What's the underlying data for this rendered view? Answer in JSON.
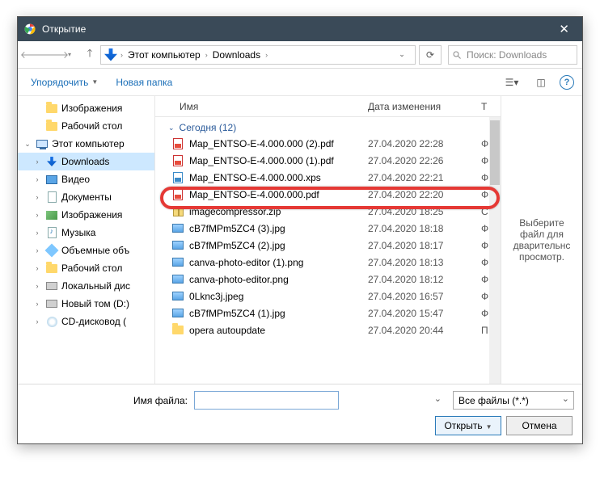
{
  "window": {
    "title": "Открытие"
  },
  "nav": {
    "crumb_root": "Этот компьютер",
    "crumb_folder": "Downloads",
    "search_placeholder": "Поиск: Downloads"
  },
  "toolbar": {
    "organize": "Упорядочить",
    "new_folder": "Новая папка"
  },
  "sidebar": {
    "items": [
      {
        "label": "Изображения",
        "icon": "folder",
        "lvl": 1
      },
      {
        "label": "Рабочий стол",
        "icon": "folder",
        "lvl": 1
      },
      {
        "label": "Этот компьютер",
        "icon": "monitor",
        "lvl": 0,
        "toggle": "⌄"
      },
      {
        "label": "Downloads",
        "icon": "dl",
        "lvl": 1,
        "toggle": "›",
        "selected": true
      },
      {
        "label": "Видео",
        "icon": "film",
        "lvl": 1,
        "toggle": "›"
      },
      {
        "label": "Документы",
        "icon": "doc",
        "lvl": 1,
        "toggle": "›"
      },
      {
        "label": "Изображения",
        "icon": "pic",
        "lvl": 1,
        "toggle": "›"
      },
      {
        "label": "Музыка",
        "icon": "note",
        "lvl": 1,
        "toggle": "›"
      },
      {
        "label": "Объемные объ",
        "icon": "cube",
        "lvl": 1,
        "toggle": "›"
      },
      {
        "label": "Рабочий стол",
        "icon": "folder",
        "lvl": 1,
        "toggle": "›"
      },
      {
        "label": "Локальный дис",
        "icon": "disk",
        "lvl": 1,
        "toggle": "›"
      },
      {
        "label": "Новый том (D:)",
        "icon": "disk",
        "lvl": 1,
        "toggle": "›"
      },
      {
        "label": "CD-дисковод (",
        "icon": "cd",
        "lvl": 1,
        "toggle": "›"
      }
    ]
  },
  "columns": {
    "name": "Имя",
    "date": "Дата изменения",
    "type": "Т"
  },
  "group": {
    "label": "Сегодня (12)"
  },
  "files": [
    {
      "name": "Map_ENTSO-E-4.000.000 (2).pdf",
      "date": "27.04.2020 22:28",
      "t": "Ф",
      "icon": "pdf"
    },
    {
      "name": "Map_ENTSO-E-4.000.000 (1).pdf",
      "date": "27.04.2020 22:26",
      "t": "Ф",
      "icon": "pdf"
    },
    {
      "name": "Map_ENTSO-E-4.000.000.xps",
      "date": "27.04.2020 22:21",
      "t": "Ф",
      "icon": "xps",
      "highlight": true
    },
    {
      "name": "Map_ENTSO-E-4.000.000.pdf",
      "date": "27.04.2020 22:20",
      "t": "Ф",
      "icon": "pdf"
    },
    {
      "name": "imagecompressor.zip",
      "date": "27.04.2020 18:25",
      "t": "С",
      "icon": "zip"
    },
    {
      "name": "cB7fMPm5ZC4 (3).jpg",
      "date": "27.04.2020 18:18",
      "t": "Ф",
      "icon": "img"
    },
    {
      "name": "cB7fMPm5ZC4 (2).jpg",
      "date": "27.04.2020 18:17",
      "t": "Ф",
      "icon": "img"
    },
    {
      "name": "canva-photo-editor (1).png",
      "date": "27.04.2020 18:13",
      "t": "Ф",
      "icon": "img"
    },
    {
      "name": "canva-photo-editor.png",
      "date": "27.04.2020 18:12",
      "t": "Ф",
      "icon": "img"
    },
    {
      "name": "0Lknc3j.jpeg",
      "date": "27.04.2020 16:57",
      "t": "Ф",
      "icon": "img"
    },
    {
      "name": "cB7fMPm5ZC4 (1).jpg",
      "date": "27.04.2020 15:47",
      "t": "Ф",
      "icon": "img"
    },
    {
      "name": "opera autoupdate",
      "date": "27.04.2020 20:44",
      "t": "П",
      "icon": "folder"
    }
  ],
  "preview": {
    "text": "Выберите файл для дварительнс просмотр."
  },
  "footer": {
    "filename_label": "Имя файла:",
    "filename_value": "",
    "filter_value": "Все файлы (*.*)",
    "open": "Открыть",
    "cancel": "Отмена"
  }
}
